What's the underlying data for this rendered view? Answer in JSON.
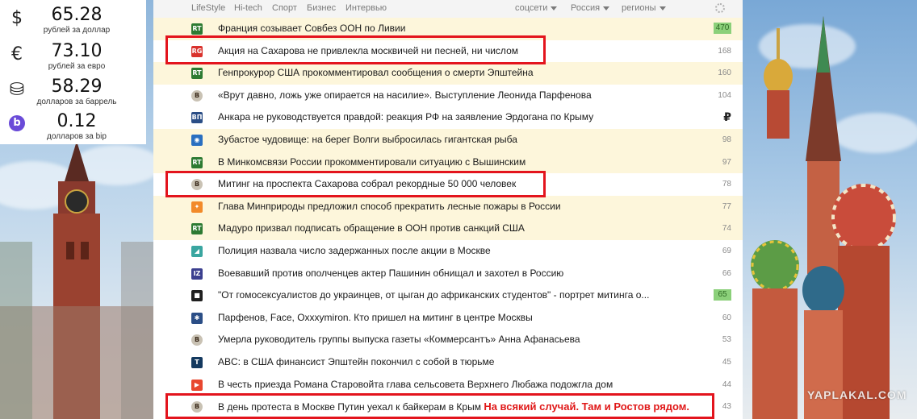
{
  "rates": [
    {
      "symbol": "$",
      "icon": "dollar-icon",
      "value": "65.28",
      "label": "рублей за доллар"
    },
    {
      "symbol": "€",
      "icon": "euro-icon",
      "value": "73.10",
      "label": "рублей за евро"
    },
    {
      "symbol": "⛁",
      "icon": "oil-barrel-icon",
      "value": "58.29",
      "label": "долларов за баррель"
    },
    {
      "symbol": "b",
      "icon": "bip-coin-icon",
      "value": "0.12",
      "label": "долларов за bip"
    }
  ],
  "nav": {
    "links": [
      "LifeStyle",
      "Hi-tech",
      "Спорт",
      "Бизнес",
      "Интервью"
    ],
    "dropdowns": [
      "соцсети",
      "Россия",
      "регионы"
    ]
  },
  "news": [
    {
      "source": "RT",
      "source_color": "#2d7a32",
      "title": "Франция созывает Совбез ООН по Ливии",
      "count": "470",
      "count_style": "green",
      "highlight": true
    },
    {
      "source": "RG",
      "source_color": "#d9322c",
      "title": "Акция на Сахарова не привлекла москвичей ни песней, ни числом",
      "count": "168",
      "count_style": "",
      "highlight": false
    },
    {
      "source": "RT",
      "source_color": "#2d7a32",
      "title": "Генпрокурор США прокомментировал сообщения о смерти Эпштейна",
      "count": "160",
      "count_style": "",
      "highlight": true
    },
    {
      "source": "В",
      "source_color": "#c9c2b4",
      "title": "«Врут давно, ложь уже опирается на насилие». Выступление Леонида Парфенова",
      "count": "104",
      "count_style": "",
      "highlight": false
    },
    {
      "source": "ВП",
      "source_color": "#2b4e86",
      "title": "Анкара не руководствуется правдой: реакция РФ на заявление Эрдогана по Крыму",
      "count": "₽",
      "count_style": "ruble",
      "highlight": false
    },
    {
      "source": "◉",
      "source_color": "#2a6fc0",
      "title": "Зубастое чудовище: на берег Волги выбросилась гигантская рыба",
      "count": "98",
      "count_style": "",
      "highlight": true
    },
    {
      "source": "RT",
      "source_color": "#2d7a32",
      "title": "В Минкомсвязи России прокомментировали ситуацию с Вышинским",
      "count": "97",
      "count_style": "",
      "highlight": true
    },
    {
      "source": "В",
      "source_color": "#c9c2b4",
      "title": "Митинг на проспекта Сахарова собрал рекордные 50 000 человек",
      "count": "78",
      "count_style": "",
      "highlight": false
    },
    {
      "source": "✦",
      "source_color": "#f28a2a",
      "title": "Глава Минприроды предложил способ прекратить лесные пожары в России",
      "count": "77",
      "count_style": "",
      "highlight": true
    },
    {
      "source": "RT",
      "source_color": "#2d7a32",
      "title": "Мадуро призвал подписать обращение в ООН против санкций США",
      "count": "74",
      "count_style": "",
      "highlight": true
    },
    {
      "source": "◢",
      "source_color": "#3aa6a0",
      "title": "Полиция назвала число задержанных после акции в Москве",
      "count": "69",
      "count_style": "",
      "highlight": false
    },
    {
      "source": "IZ",
      "source_color": "#3b3f8f",
      "title": "Воевавший против ополченцев актер Пашинин обнищал и захотел в Россию",
      "count": "66",
      "count_style": "",
      "highlight": false
    },
    {
      "source": "■",
      "source_color": "#1f1f1f",
      "title": "\"От гомосексуалистов до украинцев, от цыган до африканских студентов\" - портрет митинга о...",
      "count": "65",
      "count_style": "green",
      "highlight": false
    },
    {
      "source": "✱",
      "source_color": "#2b4e86",
      "title": "Парфенов, Face, Oxxxymiron. Кто пришел на митинг в центре Москвы",
      "count": "60",
      "count_style": "",
      "highlight": false
    },
    {
      "source": "В",
      "source_color": "#c9c2b4",
      "title": "Умерла руководитель группы выпуска газеты «Коммерсантъ» Анна Афанасьева",
      "count": "53",
      "count_style": "",
      "highlight": false
    },
    {
      "source": "T",
      "source_color": "#14395f",
      "title": "ABC: в США финансист Эпштейн покончил с собой в тюрьме",
      "count": "45",
      "count_style": "",
      "highlight": false
    },
    {
      "source": "▶",
      "source_color": "#e8472f",
      "title": "В честь приезда Романа Старовойта глава сельсовета Верхнего Любажа подожгла дом",
      "count": "44",
      "count_style": "",
      "highlight": false
    },
    {
      "source": "В",
      "source_color": "#c9c2b4",
      "title": "В день протеста в Москве Путин уехал к байкерам в Крым",
      "note": "На всякий случай. Там и Ростов рядом.",
      "count": "43",
      "count_style": "",
      "highlight": false
    }
  ],
  "watermark": "YAPLAKAL.COM",
  "colors": {
    "highlight_row": "#fdf6db",
    "frame": "#e3141d",
    "count_green": "#8bd07a",
    "note_red": "#e01818"
  }
}
